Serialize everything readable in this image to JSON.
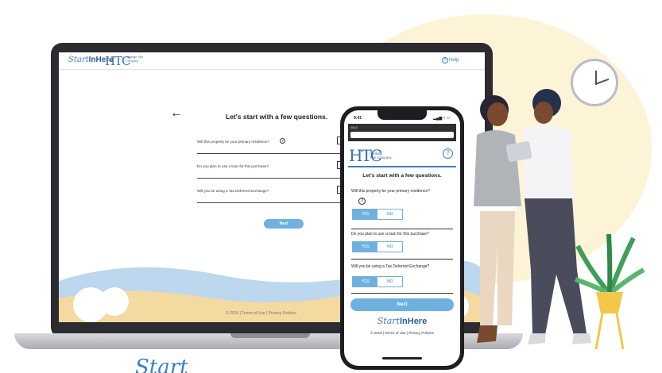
{
  "laptop": {
    "brand_script": "Start",
    "brand_bold": "InHere",
    "htc_mark": "HTC",
    "htc_name": "Heritage Title Company",
    "help_label": "Help",
    "back_arrow": "←",
    "title": "Let's start with a few questions.",
    "questions": [
      "Will this property be your primary residence?",
      "Do you plan to use a loan for this purchase?",
      "Will you be using a Tax Deferred Exchange?"
    ],
    "next_label": "Next",
    "footer": "© 2019  |  Terms of Use  |  Privacy Policies"
  },
  "phone": {
    "time": "9:41",
    "status": "▂▄▆ ≈ ▭",
    "url_label": "ABLE",
    "htc_mark": "HTC",
    "htc_name_line1": "Heritage",
    "htc_name_line2": "Title Company",
    "help_icon": "?",
    "title": "Let's start with a few questions.",
    "questions": [
      "Will this property be your primary residence?",
      "Do you plan to use a loan for this purchase?",
      "Will you be using a Tax Deferred Exchange?"
    ],
    "yes_label": "YES",
    "no_label": "NO",
    "next_label": "Next",
    "brand_script": "Start",
    "brand_bold": "InHere",
    "footer": "© 2019   |   Terms of Use   |   Privacy Policies"
  },
  "bottom_script": "Start",
  "colors": {
    "accent": "#6fb0e0",
    "brand_blue": "#3a6fb8",
    "blob": "#fdf3d6",
    "device_dark": "#2b2b30"
  }
}
